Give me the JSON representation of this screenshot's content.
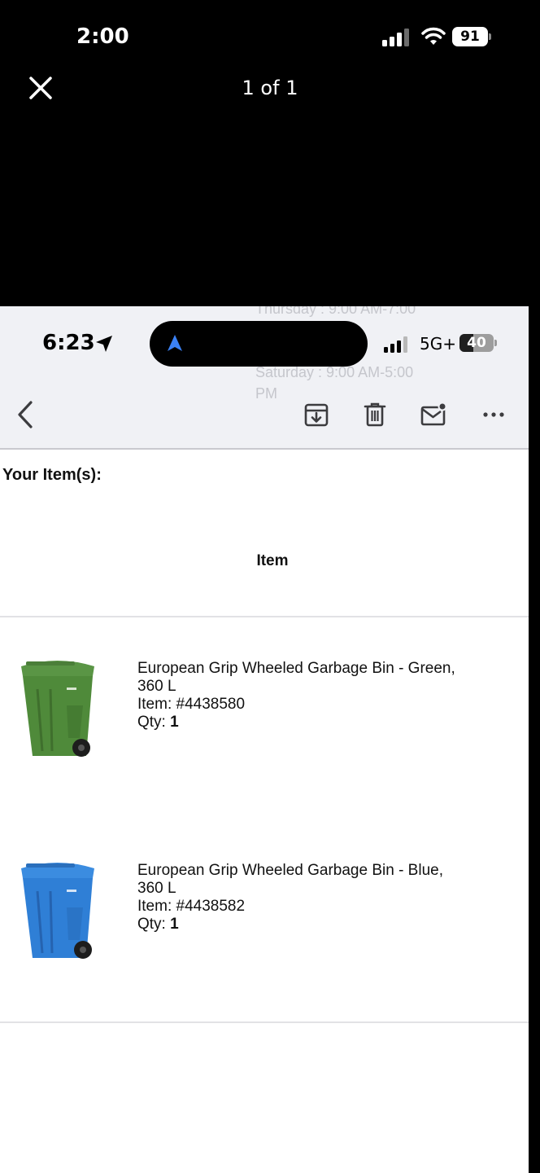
{
  "outer_viewer": {
    "status_bar": {
      "time": "2:00",
      "battery": "91"
    },
    "page_counter": "1 of 1"
  },
  "inner_screen": {
    "status_bar": {
      "time": "6:23",
      "network": "5G+",
      "battery": "40",
      "battery_level": 0.4
    },
    "ghost_text": [
      "Thursday : 9:00 AM-7:00",
      "Saturday : 9:00 AM-5:00",
      "PM"
    ],
    "toolbar": [
      "back",
      "archive",
      "trash",
      "mark-unread",
      "more"
    ]
  },
  "email": {
    "items_heading": "Your Item(s):",
    "column_header": "Item",
    "items": [
      {
        "title_line1": "European Grip Wheeled Garbage Bin - Green,",
        "title_line2": "360 L",
        "item_number": "Item: #4438580",
        "qty_label": "Qty: ",
        "qty_value": "1",
        "color": "#4f8a3a"
      },
      {
        "title_line1": "European Grip Wheeled Garbage Bin - Blue,",
        "title_line2": "360 L",
        "item_number": "Item: #4438582",
        "qty_label": "Qty: ",
        "qty_value": "1",
        "color": "#2f7fd6"
      }
    ]
  },
  "colors": {
    "accent_blue": "#3b82f6",
    "header_bg": "#f0f1f5"
  }
}
